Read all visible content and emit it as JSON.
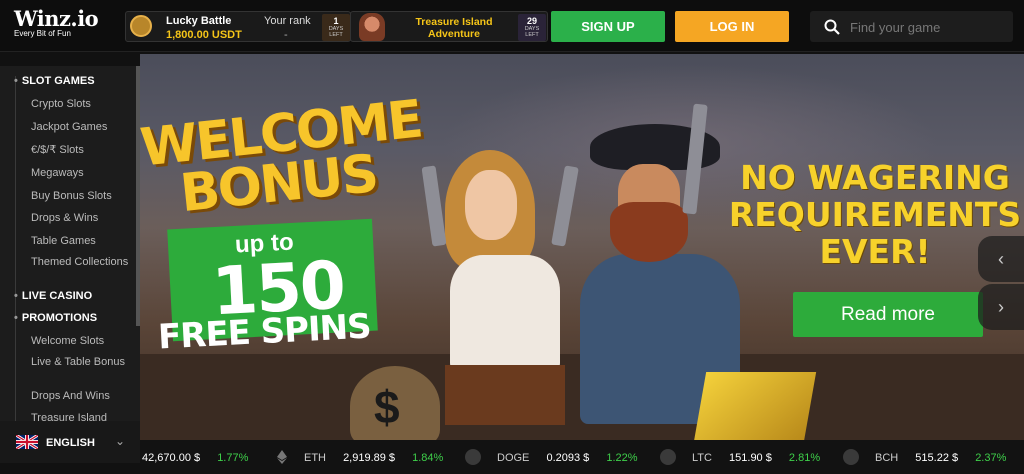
{
  "header": {
    "logo": {
      "name": "Winz.io",
      "tagline": "Every Bit of Fun"
    },
    "lucky_battle": {
      "title": "Lucky Battle",
      "amount": "1,800.00 USDT",
      "rank_label": "Your rank",
      "rank_value": "-",
      "days": "1",
      "days_label": "DAYS LEFT"
    },
    "treasure_island": {
      "title": "Treasure Island Adventure",
      "days": "29",
      "days_label": "DAYS LEFT"
    },
    "signup_label": "SIGN UP",
    "login_label": "LOG IN",
    "search": {
      "placeholder": "Find your game",
      "value": ""
    },
    "colors": {
      "signup": "#2bb04a",
      "login": "#f5a623"
    }
  },
  "sidebar": {
    "items": [
      {
        "label": "SLOT GAMES",
        "type": "head"
      },
      {
        "label": "Crypto Slots",
        "type": "sub"
      },
      {
        "label": "Jackpot Games",
        "type": "sub"
      },
      {
        "label": "€/$/₹ Slots",
        "type": "sub"
      },
      {
        "label": "Megaways",
        "type": "sub"
      },
      {
        "label": "Buy Bonus Slots",
        "type": "sub"
      },
      {
        "label": "Drops & Wins",
        "type": "sub"
      },
      {
        "label": "Table Games",
        "type": "sub"
      },
      {
        "label": "Themed Collections",
        "type": "sub"
      },
      {
        "label": "LIVE CASINO",
        "type": "head"
      },
      {
        "label": "PROMOTIONS",
        "type": "head"
      },
      {
        "label": "Welcome Slots",
        "type": "sub"
      },
      {
        "label": "Live & Table Bonus",
        "type": "sub"
      },
      {
        "label": "Drops And Wins",
        "type": "sub"
      },
      {
        "label": "Treasure Island",
        "type": "sub"
      }
    ],
    "language": "ENGLISH"
  },
  "banner": {
    "welcome_line1": "WELCOME",
    "welcome_line2": "BONUS",
    "up_to": "up to",
    "amount": "150",
    "free_spins": "FREE SPINS",
    "headline": "NO WAGERING REQUIREMENTS EVER!",
    "read_more": "Read more",
    "prev_icon": "chevron-left-icon",
    "next_icon": "chevron-right-icon"
  },
  "ticker": [
    {
      "symbol": "",
      "price": "42,670.00 $",
      "change": "1.77%"
    },
    {
      "symbol": "ETH",
      "price": "2,919.89 $",
      "change": "1.84%"
    },
    {
      "symbol": "DOGE",
      "price": "0.2093 $",
      "change": "1.22%"
    },
    {
      "symbol": "LTC",
      "price": "151.90 $",
      "change": "2.81%"
    },
    {
      "symbol": "BCH",
      "price": "515.22 $",
      "change": "2.37%"
    }
  ]
}
